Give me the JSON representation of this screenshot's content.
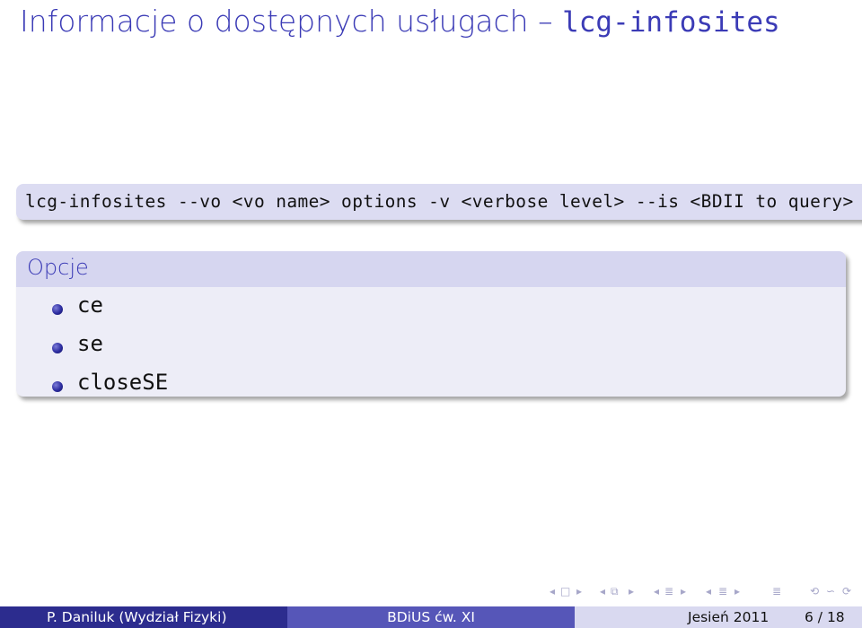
{
  "slide": {
    "title_text": "Informacje o dostępnych usługach – ",
    "title_code": "lcg-infosites",
    "command": "lcg-infosites --vo <vo name> options -v <verbose level> --is <BDII to query>",
    "block_title": "Opcje",
    "options": [
      "ce",
      "se",
      "closeSE"
    ]
  },
  "footer": {
    "author": "P. Daniluk  (Wydział Fizyki)",
    "course": "BDiUS ćw. XI",
    "date": "Jesień 2011",
    "page": "6 / 18"
  },
  "navigation": {
    "icons": [
      "nav-prev-icon",
      "nav-slide-icon",
      "nav-next-icon",
      "nav-prev-frame-icon",
      "nav-frame-icon",
      "nav-next-frame-icon",
      "nav-prev-subsection-icon",
      "nav-subsection-icon",
      "nav-next-subsection-icon",
      "nav-prev-section-icon",
      "nav-section-icon",
      "nav-next-section-icon",
      "nav-outline-icon",
      "nav-search-icon",
      "nav-back-icon",
      "nav-forward-icon"
    ]
  },
  "colors": {
    "accent": "#3b3bb6",
    "footer_dark": "#2c2c8e",
    "footer_mid": "#5656b8",
    "footer_light": "#d9d9f0",
    "block_head": "#d6d6f0",
    "block_body": "#ededf7"
  }
}
